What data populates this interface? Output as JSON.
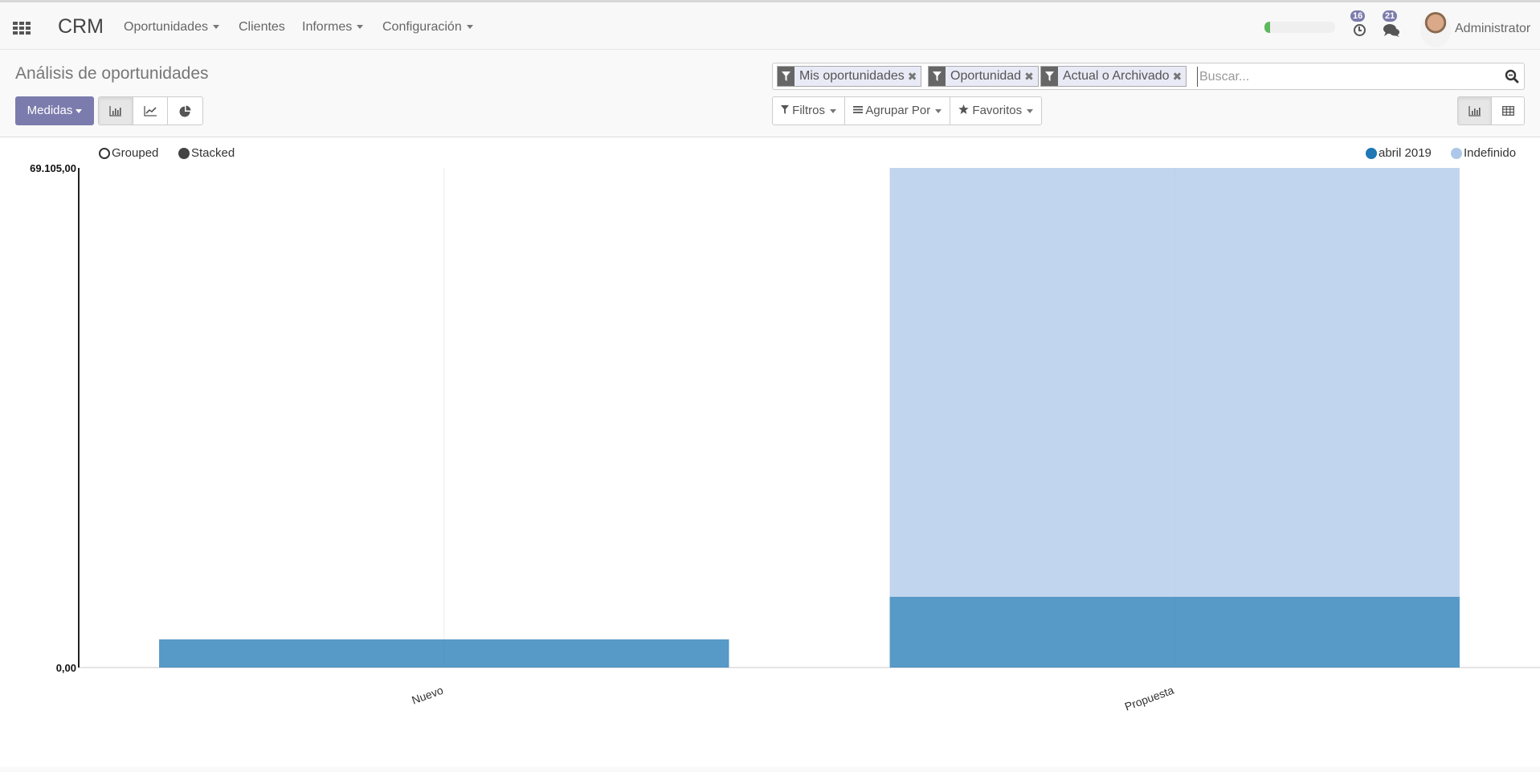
{
  "navbar": {
    "app_name": "CRM",
    "menus": [
      {
        "label": "Oportunidades",
        "dropdown": true
      },
      {
        "label": "Clientes",
        "dropdown": false
      },
      {
        "label": "Informes",
        "dropdown": true
      },
      {
        "label": "Configuración",
        "dropdown": true
      }
    ],
    "progress_fraction": 0.08,
    "activities_count": "16",
    "messages_count": "21",
    "username": "Administrator"
  },
  "control_panel": {
    "title": "Análisis de oportunidades",
    "measures_label": "Medidas",
    "chart_types": [
      "bar-chart",
      "line-chart",
      "pie-chart"
    ],
    "active_chart_type": "bar-chart",
    "facets": [
      {
        "label": "Mis oportunidades"
      },
      {
        "label": "Oportunidad"
      },
      {
        "label": "Actual o Archivado"
      }
    ],
    "search_placeholder": "Buscar...",
    "filters_label": "Filtros",
    "groupby_label": "Agrupar Por",
    "favorites_label": "Favoritos",
    "views": [
      "graph",
      "pivot"
    ],
    "active_view": "graph"
  },
  "chart_data": {
    "type": "bar",
    "mode": "stacked",
    "mode_options": [
      {
        "label": "Grouped",
        "selected": false
      },
      {
        "label": "Stacked",
        "selected": true
      }
    ],
    "categories": [
      "Nuevo",
      "Propuesta"
    ],
    "series": [
      {
        "name": "abril 2019",
        "color": "#1f77b4",
        "values": [
          3900,
          9800
        ]
      },
      {
        "name": "Indefinido",
        "color": "#aec7e8",
        "values": [
          0,
          59305
        ]
      }
    ],
    "ylim": [
      0,
      69105
    ],
    "yticks": [
      "0,00",
      "69.105,00"
    ],
    "legend": "top-right",
    "grid": true
  }
}
